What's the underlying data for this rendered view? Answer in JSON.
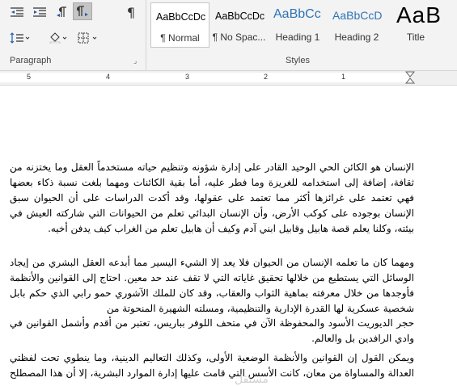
{
  "ribbon": {
    "paragraph_group": {
      "label": "Paragraph",
      "buttons": [
        "decrease-indent",
        "increase-indent",
        "left-to-right",
        "right-to-left",
        "show-marks",
        "line-spacing",
        "shading",
        "borders"
      ]
    },
    "styles_group": {
      "label": "Styles",
      "items": [
        {
          "sample": "AaBbCcDc",
          "name": "¶ Normal",
          "selected": true
        },
        {
          "sample": "AaBbCcDc",
          "name": "¶ No Spac..."
        },
        {
          "sample": "AaBbCc",
          "name": "Heading 1"
        },
        {
          "sample": "AaBbCcD",
          "name": "Heading 2"
        },
        {
          "sample": "AaB",
          "name": "Title"
        }
      ]
    }
  },
  "ruler": {
    "numbers": [
      "5",
      "4",
      "3",
      "2",
      "1"
    ]
  },
  "document": {
    "paragraphs": [
      "الإنسان هو الكائن الحي الوحيد القادر على إدارة شؤونه وتنظيم حياته مستخدماً العقل وما يختزنه من ثقافة، إضافة إلى استخدامه للغريزة وما فطر عليه، أما بقية الكائنات ومهما بلغت نسبة ذكاء بعضها فهي تعتمد على غرائزها أكثر مما تعتمد على عقولها، وقد أكدت الدراسات على أن الحيوان سبق الإنسان بوجوده على كوكب الأرض، وأن الإنسان البدائي تعلم من الحيوانات التي شاركته العيش في بيئته، وكلنا يعلم قصة هابيل وقابيل ابني آدم وكيف أن هابيل تعلم من الغراب كيف يدفن أخيه.",
      "ومهما كان ما تعلمه الإنسان من الحيوان فلا يعد إلا الشيء اليسير مما أبدعه العقل البشري من إيجاد الوسائل التي يستطيع من خلالها تحقيق غاياته التي لا تقف عند حد معين. احتاج إلى القوانين والأنظمة فأوجدها من خلال معرفته بماهية الثواب والعقاب، وقد كان للملك الآشوري حمو رابي الذي حكم بابل شخصية عسكرية لها القدرة الإدارية والتنظيمية، ومسلته الشهيرة المنحوتة من",
      "حجر الديوريت الأسود والمحفوظة الآن في متحف اللوفر بباريس، تعتبر من أقدم وأشمل القوانين في وادي الرافدين بل والعالم.",
      "ويمكن القول إن القوانين والأنظمة الوضعية الأولى، وكذلك التعاليم الدينية، وما ينطوي تحت لفظتي العدالة والمساواة من معان، كانت الأسس التي قامت عليها إدارة الموارد البشرية، إلا أن هذا المصطلح"
    ]
  },
  "watermark": "مستقل"
}
